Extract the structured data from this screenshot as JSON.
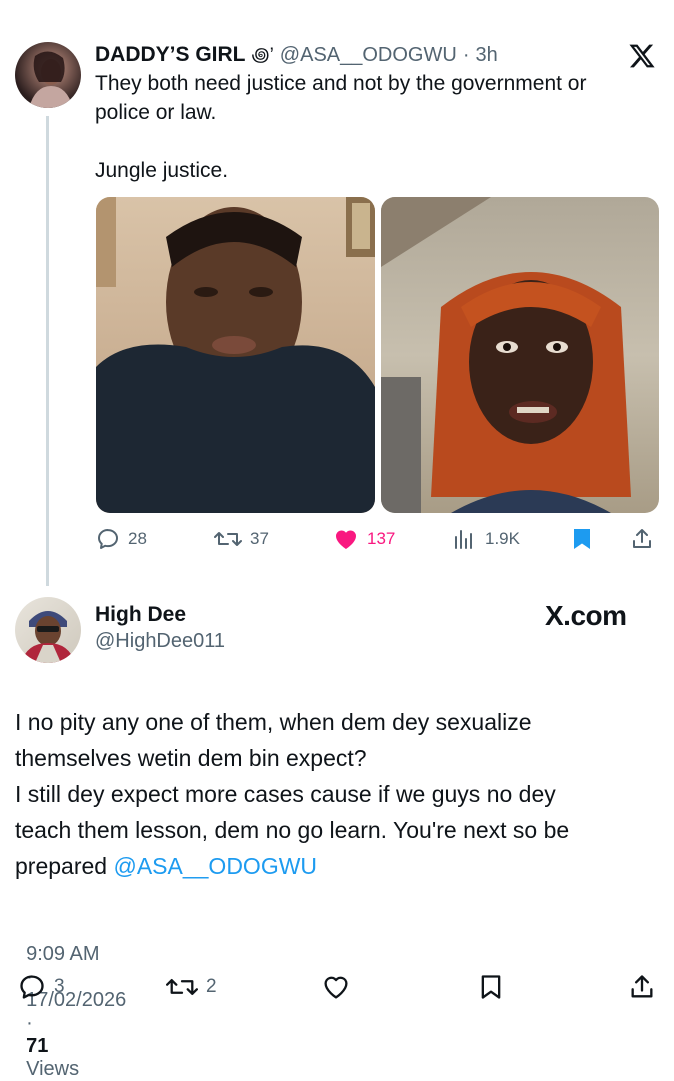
{
  "quoted_tweet": {
    "display_name": "DADDY’S GIRL",
    "name_emoji": "꩜’",
    "handle": "@ASA__ODOGWU",
    "separator": "·",
    "time": "3h",
    "text_line1": "They both need justice and not by the government or",
    "text_line2": "police or law.",
    "text_line3": "Jungle justice.",
    "actions": {
      "replies": "28",
      "reposts": "37",
      "likes": "137",
      "views": "1.9K"
    },
    "like_color": "#f91880",
    "platform_logo": "x-logo"
  },
  "reply_tweet": {
    "display_name": "High Dee",
    "handle": "@HighDee011",
    "watermark": "X.com",
    "text_line1": "I no pity any one of them, when dem dey sexualize",
    "text_line2": "themselves wetin dem bin expect?",
    "text_line3": "I still dey expect more cases cause if we guys no dey",
    "text_line4": "teach them lesson, dem no go learn. You're next so be",
    "text_line5_prefix": "prepared ",
    "mention": "@ASA__ODOGWU",
    "time": "9:09 AM",
    "sep1": "·",
    "date": "17/02/2026",
    "sep2": "·",
    "views_count": "71",
    "views_label": "Views",
    "actions": {
      "replies": "3",
      "reposts": "2"
    },
    "link_color": "#1d9bf0"
  }
}
